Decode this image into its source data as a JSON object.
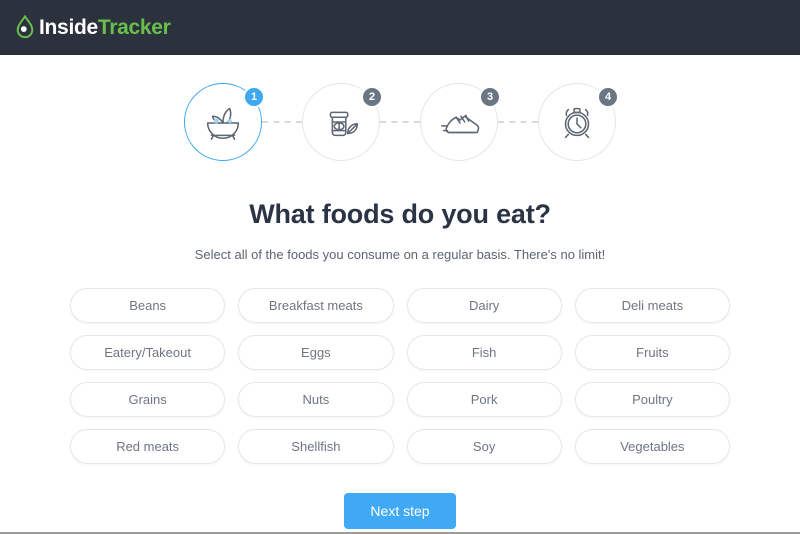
{
  "header": {
    "logo": {
      "icon": "droplet-icon",
      "text_primary": "Inside",
      "text_accent": "Tracker",
      "accent_color": "#6abf4b",
      "bar_color": "#2b323d"
    }
  },
  "stepper": {
    "active_step": 1,
    "active_color": "#3ea8f0",
    "inactive_color": "#6b7684",
    "steps": [
      {
        "number": "1",
        "icon": "salad-bowl-icon",
        "state": "active"
      },
      {
        "number": "2",
        "icon": "supplement-jar-icon",
        "state": "inactive"
      },
      {
        "number": "3",
        "icon": "running-shoe-icon",
        "state": "inactive"
      },
      {
        "number": "4",
        "icon": "alarm-clock-icon",
        "state": "inactive"
      }
    ]
  },
  "main": {
    "title": "What foods do you eat?",
    "subtitle": "Select all of the foods you consume on a regular basis. There's no limit!",
    "options": [
      {
        "label": "Beans"
      },
      {
        "label": "Breakfast meats"
      },
      {
        "label": "Dairy"
      },
      {
        "label": "Deli meats"
      },
      {
        "label": "Eatery/Takeout"
      },
      {
        "label": "Eggs"
      },
      {
        "label": "Fish"
      },
      {
        "label": "Fruits"
      },
      {
        "label": "Grains"
      },
      {
        "label": "Nuts"
      },
      {
        "label": "Pork"
      },
      {
        "label": "Poultry"
      },
      {
        "label": "Red meats"
      },
      {
        "label": "Shellfish"
      },
      {
        "label": "Soy"
      },
      {
        "label": "Vegetables"
      }
    ]
  },
  "footer": {
    "next_label": "Next step",
    "next_color": "#40a9f5"
  }
}
